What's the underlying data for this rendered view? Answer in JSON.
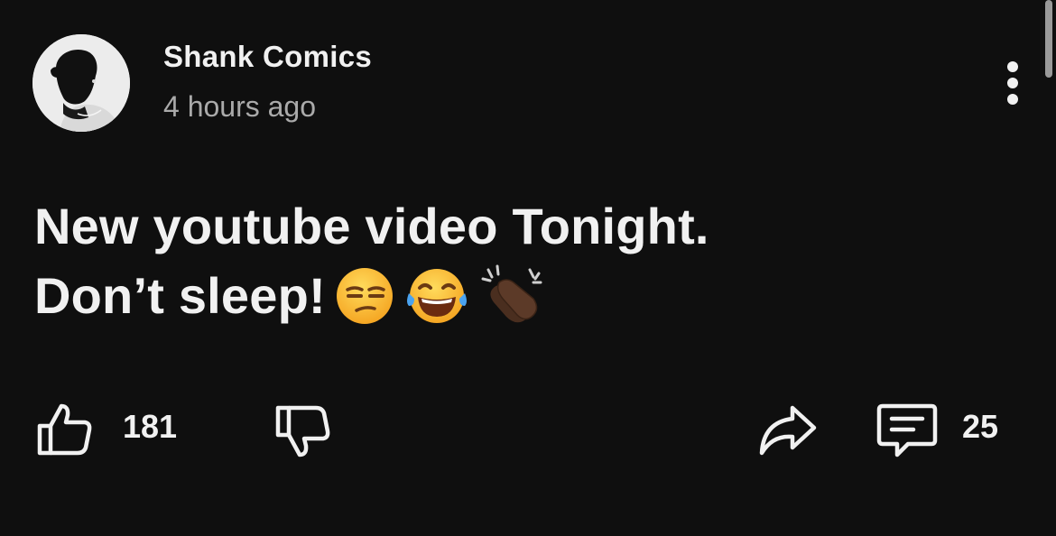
{
  "post": {
    "author": "Shank Comics",
    "time": "4 hours ago",
    "text_line1": "New youtube video Tonight.",
    "text_line2": "Don’t sleep!",
    "emojis": [
      "unamused-face",
      "face-with-tears-of-joy",
      "clapping-hands-dark-skin-tone"
    ]
  },
  "actions": {
    "like_count": "181",
    "comment_count": "25",
    "icons": [
      "thumbs-up-icon",
      "thumbs-down-icon",
      "share-icon",
      "comment-icon"
    ]
  },
  "colors": {
    "background": "#0f0f0f",
    "text": "#f1f1f1",
    "secondary_text": "#aaaaaa"
  }
}
